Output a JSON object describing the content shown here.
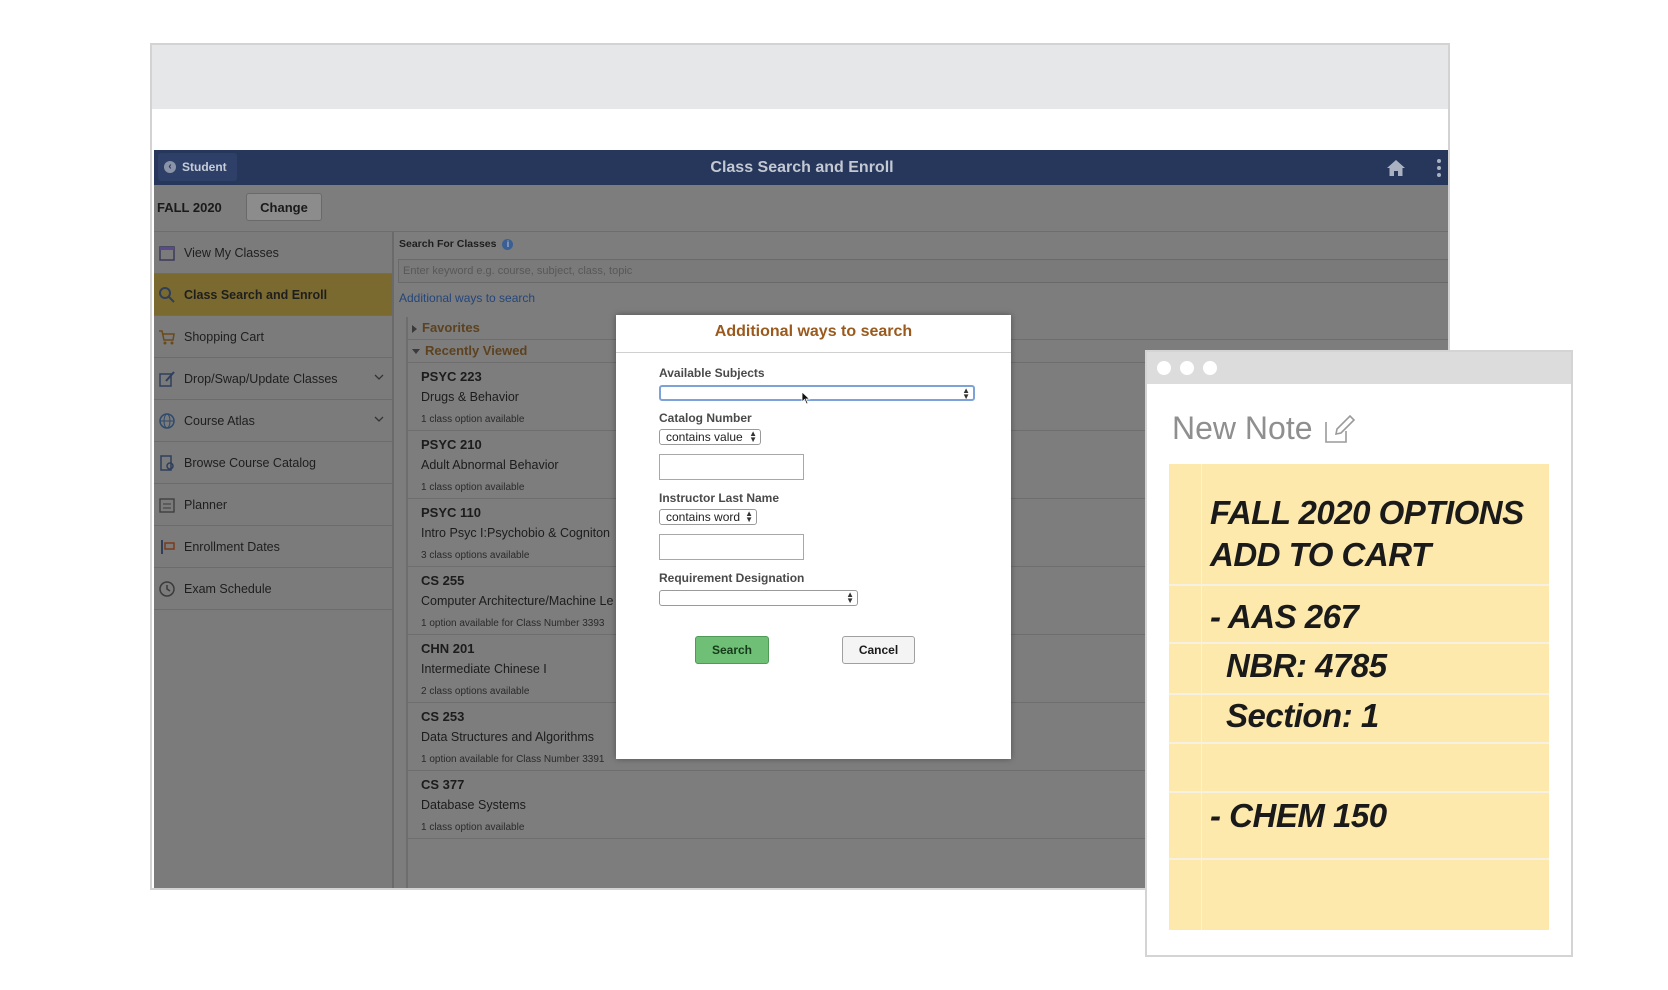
{
  "header": {
    "back_label": "Student",
    "title": "Class Search and Enroll"
  },
  "term": {
    "label": "FALL 2020",
    "change_label": "Change"
  },
  "sidebar": {
    "items": [
      {
        "label": "View My Classes",
        "icon": "calendar-icon"
      },
      {
        "label": "Class Search and Enroll",
        "icon": "search-icon",
        "active": true
      },
      {
        "label": "Shopping Cart",
        "icon": "cart-icon"
      },
      {
        "label": "Drop/Swap/Update Classes",
        "icon": "edit-icon",
        "expandable": true
      },
      {
        "label": "Course Atlas",
        "icon": "globe-icon",
        "expandable": true
      },
      {
        "label": "Browse Course Catalog",
        "icon": "catalog-icon"
      },
      {
        "label": "Planner",
        "icon": "planner-icon"
      },
      {
        "label": "Enrollment Dates",
        "icon": "dates-icon"
      },
      {
        "label": "Exam Schedule",
        "icon": "clock-icon"
      }
    ]
  },
  "search": {
    "heading": "Search For Classes",
    "placeholder": "Enter keyword e.g. course, subject, class, topic",
    "more_link": "Additional ways to search"
  },
  "groups": {
    "favorites": "Favorites",
    "recent": "Recently Viewed"
  },
  "courses": [
    {
      "code": "PSYC 223",
      "name": "Drugs & Behavior",
      "avail": "1 class option available"
    },
    {
      "code": "PSYC 210",
      "name": "Adult Abnormal Behavior",
      "avail": "1 class option available"
    },
    {
      "code": "PSYC 110",
      "name": "Intro Psyc I:Psychobio & Cogniton",
      "avail": "3 class options available"
    },
    {
      "code": "CS 255",
      "name": "Computer Architecture/Machine Le",
      "avail": "1 option available for Class Number 3393"
    },
    {
      "code": "CHN 201",
      "name": "Intermediate Chinese I",
      "avail": "2 class options available"
    },
    {
      "code": "CS 253",
      "name": "Data Structures and Algorithms",
      "avail": "1 option available for Class Number 3391"
    },
    {
      "code": "CS 377",
      "name": "Database Systems",
      "avail": "1 class option available"
    }
  ],
  "modal": {
    "title": "Additional ways to search",
    "subjects_label": "Available Subjects",
    "subjects_value": "",
    "catalog_label": "Catalog Number",
    "catalog_op": "contains value",
    "instructor_label": "Instructor Last Name",
    "instructor_op": "contains word",
    "requirement_label": "Requirement Designation",
    "requirement_value": "",
    "search_label": "Search",
    "cancel_label": "Cancel"
  },
  "note": {
    "title": "New Note",
    "lines": [
      "FALL 2020 OPTIONS",
      "ADD TO CART",
      "- AAS 267",
      "NBR: 4785",
      "Section: 1",
      "- CHEM 150"
    ]
  },
  "colors": {
    "header_bg": "#27375b",
    "active_item": "#7b6a2f",
    "modal_title": "#9b5a1d",
    "search_button": "#6fbf77",
    "note_pad": "#fde9ac"
  }
}
